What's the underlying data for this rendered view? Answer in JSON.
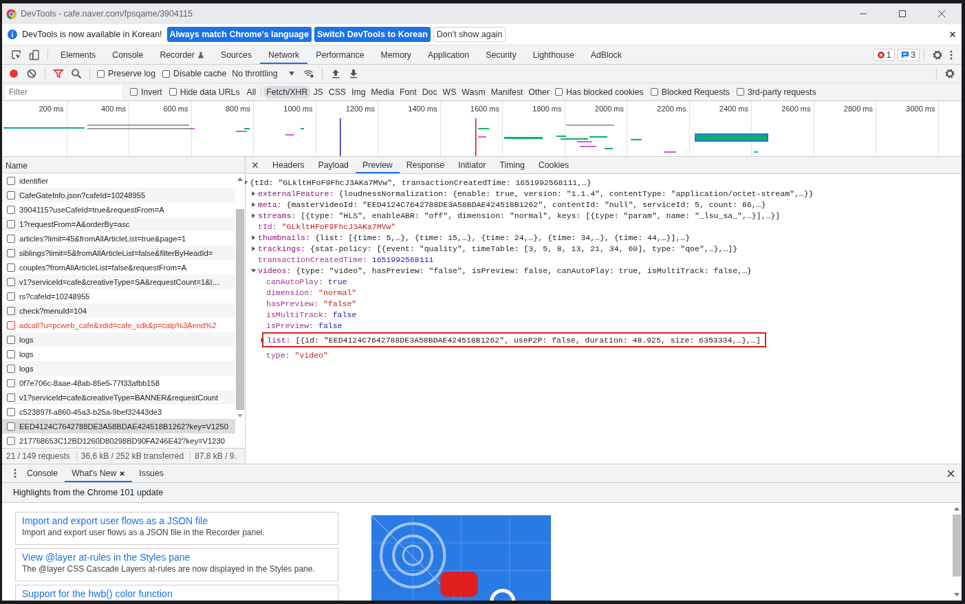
{
  "window": {
    "title": "DevTools - cafe.naver.com/fpsqame/3904115"
  },
  "infobar": {
    "message": "DevTools is now available in Korean!",
    "buttons": [
      {
        "label": "Always match Chrome's language",
        "kind": "primary"
      },
      {
        "label": "Switch DevTools to Korean",
        "kind": "primary"
      },
      {
        "label": "Don't show again",
        "kind": "secondary"
      }
    ]
  },
  "panel_tabs": [
    {
      "label": "Elements",
      "selected": false,
      "experimental": false
    },
    {
      "label": "Console",
      "selected": false,
      "experimental": false
    },
    {
      "label": "Recorder",
      "selected": false,
      "experimental": true
    },
    {
      "label": "Sources",
      "selected": false,
      "experimental": false
    },
    {
      "label": "Network",
      "selected": true,
      "experimental": false
    },
    {
      "label": "Performance",
      "selected": false,
      "experimental": false
    },
    {
      "label": "Memory",
      "selected": false,
      "experimental": false
    },
    {
      "label": "Application",
      "selected": false,
      "experimental": false
    },
    {
      "label": "Security",
      "selected": false,
      "experimental": false
    },
    {
      "label": "Lighthouse",
      "selected": false,
      "experimental": false
    },
    {
      "label": "AdBlock",
      "selected": false,
      "experimental": false
    }
  ],
  "issue_counters": {
    "errors": "1",
    "messages": "3"
  },
  "network_toolbar": {
    "recording": true,
    "filter_active": true,
    "checkboxes": [
      {
        "label": "Preserve log",
        "checked": false
      },
      {
        "label": "Disable cache",
        "checked": false
      }
    ],
    "throttling": "No throttling"
  },
  "filter_bar": {
    "placeholder": "Filter",
    "options": [
      {
        "label": "Invert",
        "checked": false
      },
      {
        "label": "Hide data URLs",
        "checked": false
      }
    ],
    "types": [
      {
        "label": "All",
        "selected": false
      },
      {
        "label": "Fetch/XHR",
        "selected": true
      },
      {
        "label": "JS",
        "selected": false
      },
      {
        "label": "CSS",
        "selected": false
      },
      {
        "label": "Img",
        "selected": false
      },
      {
        "label": "Media",
        "selected": false
      },
      {
        "label": "Font",
        "selected": false
      },
      {
        "label": "Doc",
        "selected": false
      },
      {
        "label": "WS",
        "selected": false
      },
      {
        "label": "Wasm",
        "selected": false
      },
      {
        "label": "Manifest",
        "selected": false
      },
      {
        "label": "Other",
        "selected": false
      }
    ],
    "extra_options": [
      {
        "label": "Has blocked cookies",
        "checked": false
      },
      {
        "label": "Blocked Requests",
        "checked": false
      },
      {
        "label": "3rd-party requests",
        "checked": false
      }
    ]
  },
  "timeline": {
    "ticks": [
      "200 ms",
      "400 ms",
      "600 ms",
      "800 ms",
      "1000 ms",
      "1200 ms",
      "1400 ms",
      "1600 ms",
      "1800 ms",
      "2000 ms",
      "2200 ms",
      "2400 ms",
      "2600 ms",
      "2800 ms",
      "3000 ms"
    ]
  },
  "requests": {
    "column": "Name",
    "rows": [
      {
        "name": "identifier",
        "selected": false,
        "failed": false
      },
      {
        "name": "CafeGateInfo.json?cafeId=10248955",
        "selected": false,
        "failed": false
      },
      {
        "name": "3904115?useCafeId=true&requestFrom=A",
        "selected": false,
        "failed": false
      },
      {
        "name": "1?requestFrom=A&orderBy=asc",
        "selected": false,
        "failed": false
      },
      {
        "name": "articles?limit=45&fromAllArticleList=true&page=1",
        "selected": false,
        "failed": false
      },
      {
        "name": "siblings?limit=5&fromAllArticleList=false&filterByHeadId=",
        "selected": false,
        "failed": false
      },
      {
        "name": "couples?fromAllArticleList=false&requestFrom=A",
        "selected": false,
        "failed": false
      },
      {
        "name": "v1?serviceId=cafe&creativeType=SA&requestCount=1&l…",
        "selected": false,
        "failed": false
      },
      {
        "name": "rs?cafeId=10248955",
        "selected": false,
        "failed": false
      },
      {
        "name": "check?menuId=104",
        "selected": false,
        "failed": false
      },
      {
        "name": "adcall?u=pcweb_cafe&xdid=cafe_sdk&p=calp%3Aend%2",
        "selected": false,
        "failed": true
      },
      {
        "name": "logs",
        "selected": false,
        "failed": false
      },
      {
        "name": "logs",
        "selected": false,
        "failed": false
      },
      {
        "name": "logs",
        "selected": false,
        "failed": false
      },
      {
        "name": "0f7e706c-8aae-48ab-85e5-77f33afbb158",
        "selected": false,
        "failed": false
      },
      {
        "name": "v1?serviceId=cafe&creativeType=BANNER&requestCount",
        "selected": false,
        "failed": false
      },
      {
        "name": "c523897f-a860-45a3-b25a-9bef32443de3",
        "selected": false,
        "failed": false
      },
      {
        "name": "EED4124C7642788DE3A58BDAE424518B1262?key=V1250",
        "selected": true,
        "failed": false
      },
      {
        "name": "217768653C12BD1260D80298BD90FA246E42?key=V1230",
        "selected": false,
        "failed": false
      }
    ]
  },
  "status": [
    "21 / 149 requests",
    "36.6 kB / 252 kB transferred",
    "87.8 kB / 9."
  ],
  "detail_tabs": [
    {
      "label": "Headers",
      "selected": false
    },
    {
      "label": "Payload",
      "selected": false
    },
    {
      "label": "Preview",
      "selected": true
    },
    {
      "label": "Response",
      "selected": false
    },
    {
      "label": "Initiator",
      "selected": false
    },
    {
      "label": "Timing",
      "selected": false
    },
    {
      "label": "Cookies",
      "selected": false
    }
  ],
  "preview": {
    "kind": "object",
    "expanded": true,
    "summary": "{tId: \"GLkltHFoF9FhcJ3AKa7MVw\", transactionCreatedTime: 1651992568111,…}",
    "children": [
      {
        "kind": "object",
        "key": "externalFeature:",
        "expanded": false,
        "summary": "{loudnessNormalization: {enable: true, version: \"1.1.4\", contentType: \"application/octet-stream\",…}}"
      },
      {
        "kind": "object",
        "key": "meta:",
        "expanded": false,
        "summary": "{masterVideoId: \"EED4124C7642788DE3A58BDAE424518B1262\", contentId: \"null\", serviceId: 5, count: 86,…}"
      },
      {
        "kind": "object",
        "key": "streams:",
        "expanded": false,
        "summary": "[{type: \"HLS\", enableABR: \"off\", dimension: \"normal\", keys: [{type: \"param\", name: \"_lsu_sa_\",…}],…}]"
      },
      {
        "kind": "string",
        "key": "tId:",
        "value": "\"GLkltHFoF9FhcJ3AKa7MVw\""
      },
      {
        "kind": "object",
        "key": "thumbnails:",
        "expanded": false,
        "summary": "{list: [{time: 5,…}, {time: 15,…}, {time: 24,…}, {time: 34,…}, {time: 44,…}],…}"
      },
      {
        "kind": "object",
        "key": "trackings:",
        "expanded": false,
        "summary": "{stat-policy: [{event: \"quality\", timeTable: [3, 5, 8, 13, 21, 34, 60], type: \"qoe\",…},…]}"
      },
      {
        "kind": "number",
        "key": "transactionCreatedTime:",
        "value": "1651992568111"
      },
      {
        "kind": "object",
        "key": "videos:",
        "expanded": true,
        "summary": "{type: \"video\", hasPreview: \"false\", isPreview: false, canAutoPlay: true, isMultiTrack: false,…}",
        "children": [
          {
            "kind": "boolean",
            "key": "canAutoPlay:",
            "value": "true"
          },
          {
            "kind": "string",
            "key": "dimension:",
            "value": "\"normal\""
          },
          {
            "kind": "string",
            "key": "hasPreview:",
            "value": "\"false\""
          },
          {
            "kind": "boolean",
            "key": "isMultiTrack:",
            "value": "false"
          },
          {
            "kind": "boolean",
            "key": "isPreview:",
            "value": "false"
          },
          {
            "kind": "object",
            "key": "list:",
            "expanded": false,
            "outlined": true,
            "summary": "[{id: \"EED4124C7642788DE3A58BDAE424518B1262\", useP2P: false, duration: 48.925, size: 6353334,…},…]"
          },
          {
            "kind": "string",
            "key": "type:",
            "value": "\"video\""
          }
        ]
      }
    ]
  },
  "drawer": {
    "tabs": [
      {
        "label": "Console",
        "selected": false,
        "closable": false
      },
      {
        "label": "What's New",
        "selected": true,
        "closable": true
      },
      {
        "label": "Issues",
        "selected": false,
        "closable": false
      }
    ],
    "heading": "Highlights from the Chrome 101 update",
    "articles": [
      {
        "title": "Import and export user flows as a JSON file",
        "description": "Import and export user flows as a JSON file in the Recorder panel."
      },
      {
        "title": "View @layer at-rules in the Styles pane",
        "description": "The @layer CSS Cascade Layers at-rules are now displayed in the Styles pane."
      },
      {
        "title": "Support for the hwb() color function"
      }
    ]
  }
}
